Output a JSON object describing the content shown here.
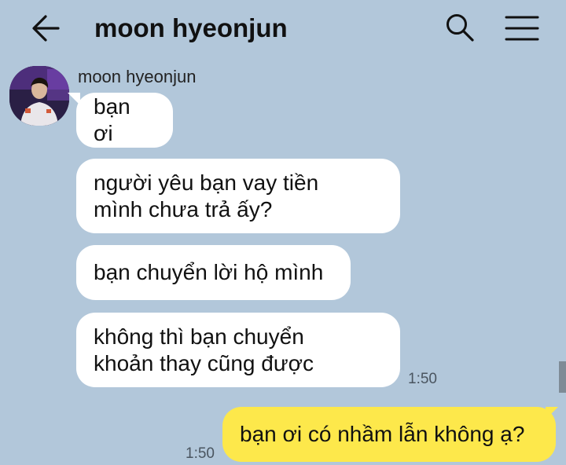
{
  "header": {
    "title": "moon hyeonjun",
    "back_icon": "arrow-left-icon",
    "search_icon": "search-icon",
    "menu_icon": "hamburger-menu-icon"
  },
  "colors": {
    "background": "#b2c7da",
    "incoming_bubble": "#ffffff",
    "outgoing_bubble": "#fde84b"
  },
  "incoming": {
    "sender_name": "moon hyeonjun",
    "messages": [
      "bạn ơi",
      "người yêu bạn vay tiền\nmình chưa trả ấy?",
      "bạn chuyển lời hộ mình",
      "không thì bạn chuyển\nkhoản thay cũng được"
    ],
    "time": "1:50"
  },
  "outgoing": {
    "message": "bạn ơi có nhầm lẫn không ạ?",
    "time": "1:50"
  }
}
